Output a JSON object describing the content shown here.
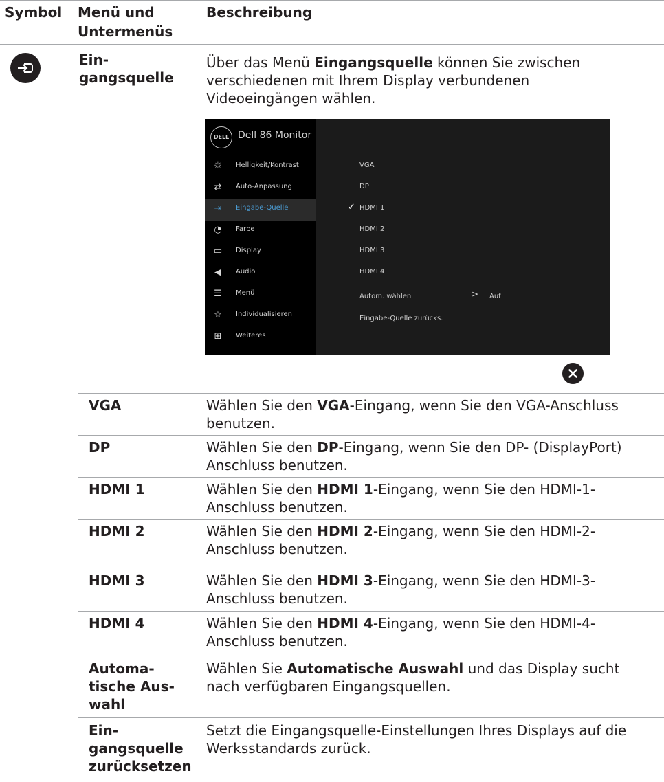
{
  "header": {
    "col1": "Symbol",
    "col2a": "Menü und",
    "col2b": "Untermenüs",
    "col3": "Beschreibung"
  },
  "main_item": {
    "label_a": "Ein-",
    "label_b": "gangsquelle",
    "icon": "input-source-icon",
    "desc_pre": "Über das Menü ",
    "desc_bold": "Eingangsquelle",
    "desc_post_1": " können Sie zwischen",
    "desc_line2": "verschiedenen mit Ihrem Display verbundenen",
    "desc_line3": "Videoeingängen wählen."
  },
  "osd": {
    "logo": "DELL",
    "title": "Dell 86 Monitor",
    "menu": [
      {
        "label": "Helligkeit/Kontrast",
        "icon": "brightness-icon"
      },
      {
        "label": "Auto-Anpassung",
        "icon": "auto-adjust-icon"
      },
      {
        "label": "Eingabe-Quelle",
        "icon": "input-source-icon"
      },
      {
        "label": "Farbe",
        "icon": "color-icon"
      },
      {
        "label": "Display",
        "icon": "display-icon"
      },
      {
        "label": "Audio",
        "icon": "audio-icon"
      },
      {
        "label": "Menü",
        "icon": "menu-icon"
      },
      {
        "label": "Individualisieren",
        "icon": "star-icon"
      },
      {
        "label": "Weiteres",
        "icon": "others-icon"
      }
    ],
    "options": [
      "VGA",
      "DP",
      "HDMI 1",
      "HDMI 2",
      "HDMI 3",
      "HDMI 4",
      "Autom. wählen",
      "Eingabe-Quelle zurücks."
    ],
    "auto_value": "Auf",
    "arrow": ">",
    "check": "✓",
    "close_icon": "close-icon"
  },
  "rows": [
    {
      "label": "VGA",
      "pre": "Wählen Sie den ",
      "bold": "VGA",
      "post": "-Eingang, wenn Sie den VGA-Anschluss",
      "line2": "benutzen."
    },
    {
      "label": "DP",
      "pre": "Wählen Sie den ",
      "bold": "DP",
      "post": "-Eingang, wenn Sie den DP- (DisplayPort)",
      "line2": "Anschluss benutzen."
    },
    {
      "label": "HDMI 1",
      "pre": "Wählen Sie den ",
      "bold": "HDMI 1",
      "post": "-Eingang, wenn Sie den HDMI-1-",
      "line2": "Anschluss benutzen."
    },
    {
      "label": "HDMI 2",
      "pre": "Wählen Sie den ",
      "bold": "HDMI 2",
      "post": "-Eingang, wenn Sie den HDMI-2-",
      "line2": "Anschluss benutzen."
    },
    {
      "label": "HDMI 3",
      "pre": "Wählen Sie den ",
      "bold": "HDMI 3",
      "post": "-Eingang, wenn Sie den HDMI-3-",
      "line2": "Anschluss benutzen."
    },
    {
      "label": "HDMI 4",
      "pre": "Wählen Sie den ",
      "bold": "HDMI 4",
      "post": "-Eingang, wenn Sie den HDMI-4-",
      "line2": "Anschluss benutzen."
    }
  ],
  "auto_row": {
    "label_a": "Automa-",
    "label_b": "tische Aus-",
    "label_c": "wahl",
    "pre": "Wählen Sie ",
    "bold": "Automatische Auswahl",
    "post": " und das Display sucht",
    "line2": "nach verfügbaren Eingangsquellen."
  },
  "reset_row": {
    "label_a": "Ein-",
    "label_b": "gangsquelle",
    "label_c": "zurücksetzen",
    "line1": "Setzt die Eingangsquelle-Einstellungen Ihres Displays auf die",
    "line2": "Werksstandards zurück."
  }
}
